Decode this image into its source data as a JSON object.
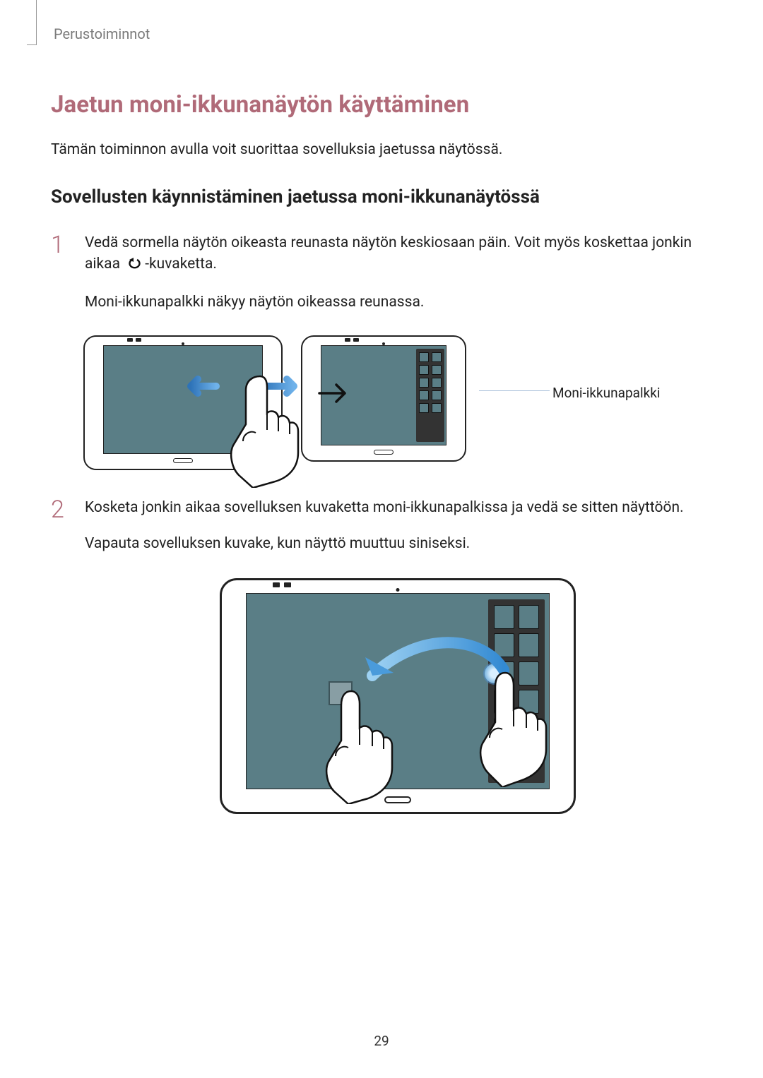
{
  "breadcrumb": "Perustoiminnot",
  "h1": "Jaetun moni-ikkunanäytön käyttäminen",
  "intro": "Tämän toiminnon avulla voit suorittaa sovelluksia jaetussa näytössä.",
  "h2": "Sovellusten käynnistäminen jaetussa moni-ikkunanäytössä",
  "steps": {
    "s1_num": "1",
    "s1_part1": "Vedä sormella näytön oikeasta reunasta näytön keskiosaan päin. Voit myös koskettaa jonkin aikaa ",
    "s1_part2": "-kuvaketta.",
    "s1_line2": "Moni-ikkunapalkki näkyy näytön oikeassa reunassa.",
    "s2_num": "2",
    "s2_line1": "Kosketa jonkin aikaa sovelluksen kuvaketta moni-ikkunapalkissa ja vedä se sitten näyttöön.",
    "s2_line2": "Vapauta sovelluksen kuvake, kun näyttö muuttuu siniseksi."
  },
  "callout": "Moni-ikkunapalkki",
  "page_number": "29"
}
